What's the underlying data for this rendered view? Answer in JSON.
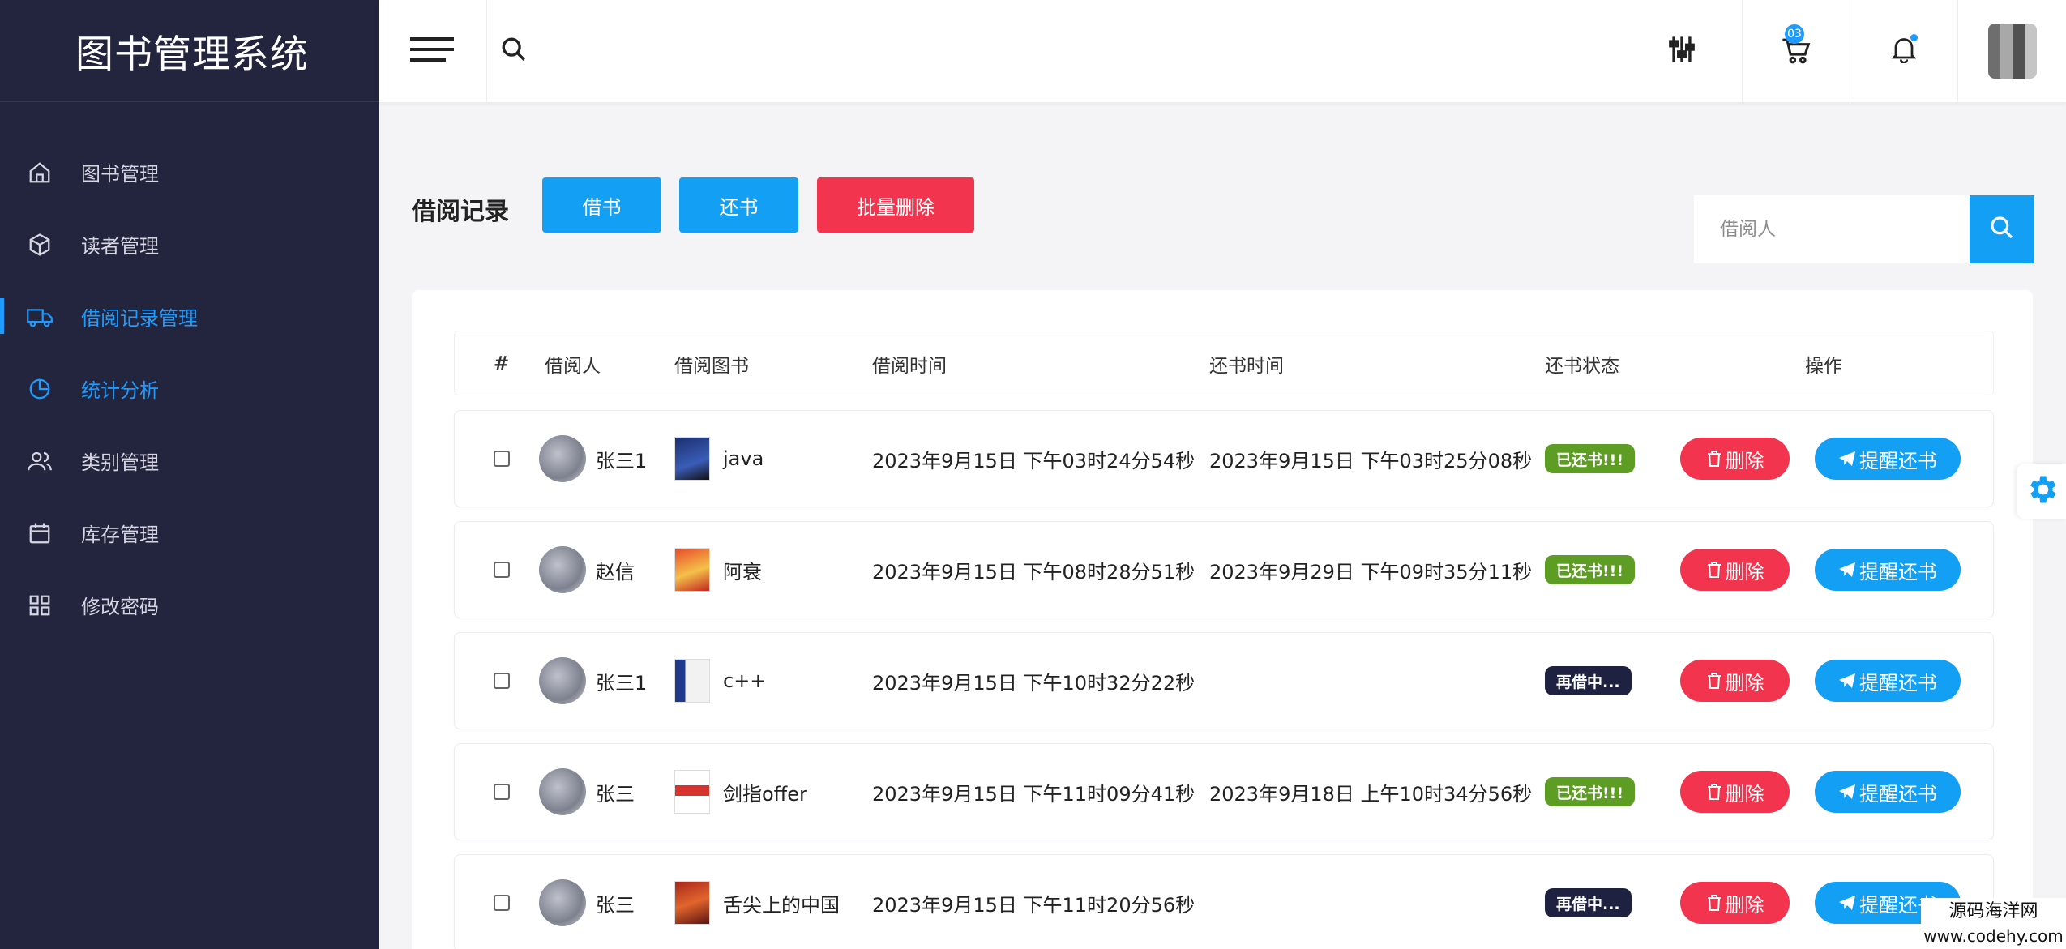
{
  "app": {
    "title": "图书管理系统"
  },
  "sidebar": {
    "items": [
      {
        "label": "图书管理",
        "icon": "home-icon"
      },
      {
        "label": "读者管理",
        "icon": "box-icon"
      },
      {
        "label": "借阅记录管理",
        "icon": "truck-icon",
        "active": true
      },
      {
        "label": "统计分析",
        "icon": "pie-chart-icon"
      },
      {
        "label": "类别管理",
        "icon": "users-icon"
      },
      {
        "label": "库存管理",
        "icon": "calendar-icon"
      },
      {
        "label": "修改密码",
        "icon": "grid-icon"
      }
    ]
  },
  "topbar": {
    "cart_count": "03"
  },
  "page": {
    "title": "借阅记录",
    "borrow_label": "借书",
    "return_label": "还书",
    "batch_delete_label": "批量删除",
    "search_placeholder": "借阅人"
  },
  "table": {
    "headers": [
      "#",
      "借阅人",
      "借阅图书",
      "借阅时间",
      "还书时间",
      "还书状态",
      "操作"
    ],
    "delete_label": "删除",
    "remind_label": "提醒还书",
    "rows": [
      {
        "borrower": "张三1",
        "book": "java",
        "borrow_time": "2023年9月15日 下午03时24分54秒",
        "return_time": "2023年9月15日 下午03时25分08秒",
        "status": "已还书!!!",
        "status_type": "done"
      },
      {
        "borrower": "赵信",
        "book": "阿衰",
        "borrow_time": "2023年9月15日 下午08时28分51秒",
        "return_time": "2023年9月29日 下午09时35分11秒",
        "status": "已还书!!!",
        "status_type": "done"
      },
      {
        "borrower": "张三1",
        "book": "c++",
        "borrow_time": "2023年9月15日 下午10时32分22秒",
        "return_time": "",
        "status": "再借中...",
        "status_type": "borrow"
      },
      {
        "borrower": "张三",
        "book": "剑指offer",
        "borrow_time": "2023年9月15日 下午11时09分41秒",
        "return_time": "2023年9月18日 上午10时34分56秒",
        "status": "已还书!!!",
        "status_type": "done"
      },
      {
        "borrower": "张三",
        "book": "舌尖上的中国",
        "borrow_time": "2023年9月15日 下午11时20分56秒",
        "return_time": "",
        "status": "再借中...",
        "status_type": "borrow"
      }
    ]
  },
  "footer_brand": {
    "name": "源码海洋网",
    "url": "www.codehy.com"
  },
  "colors": {
    "primary": "#13a0f4",
    "danger": "#f2344f",
    "sidebar": "#23243d",
    "done": "#5e9d24",
    "borrowing": "#1e2140"
  }
}
